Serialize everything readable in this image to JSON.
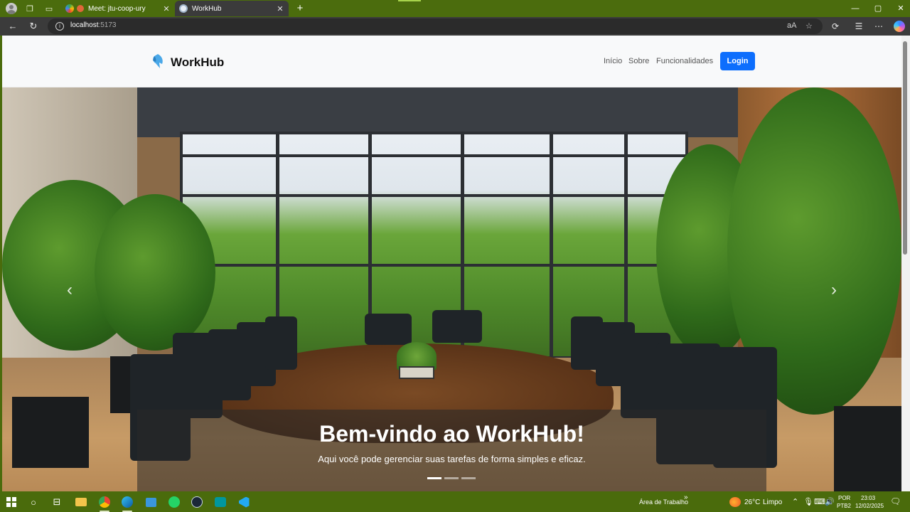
{
  "browser": {
    "tabs": [
      {
        "title": "Meet: jtu-coop-ury",
        "active": false
      },
      {
        "title": "WorkHub",
        "active": true
      }
    ],
    "close_glyph": "✕",
    "new_tab_glyph": "+",
    "address": {
      "host": "localhost",
      "port": ":5173"
    },
    "window_controls": {
      "minimize": "—",
      "maximize": "▢",
      "close": "✕"
    }
  },
  "site": {
    "brand": "WorkHub",
    "nav": {
      "links": [
        "Início",
        "Sobre",
        "Funcionalidades"
      ],
      "login_label": "Login"
    },
    "hero": {
      "title": "Bem-vindo ao WorkHub!",
      "subtitle": "Aqui você pode gerenciar suas tarefas de forma simples e eficaz.",
      "slides_count": 3,
      "active_slide": 1,
      "prev_glyph": "‹",
      "next_glyph": "›"
    }
  },
  "taskbar": {
    "desktop_label": "Área de Trabalho",
    "chevron": "»",
    "weather": {
      "temp": "26°C",
      "condition": "Limpo"
    },
    "language": {
      "line1": "POR",
      "line2": "PTB2"
    },
    "clock": {
      "time": "23:03",
      "date": "12/02/2025"
    }
  },
  "colors": {
    "accent": "#0d6efd",
    "taskbar": "#4a6b0c",
    "logo": "#4aa8e8"
  }
}
